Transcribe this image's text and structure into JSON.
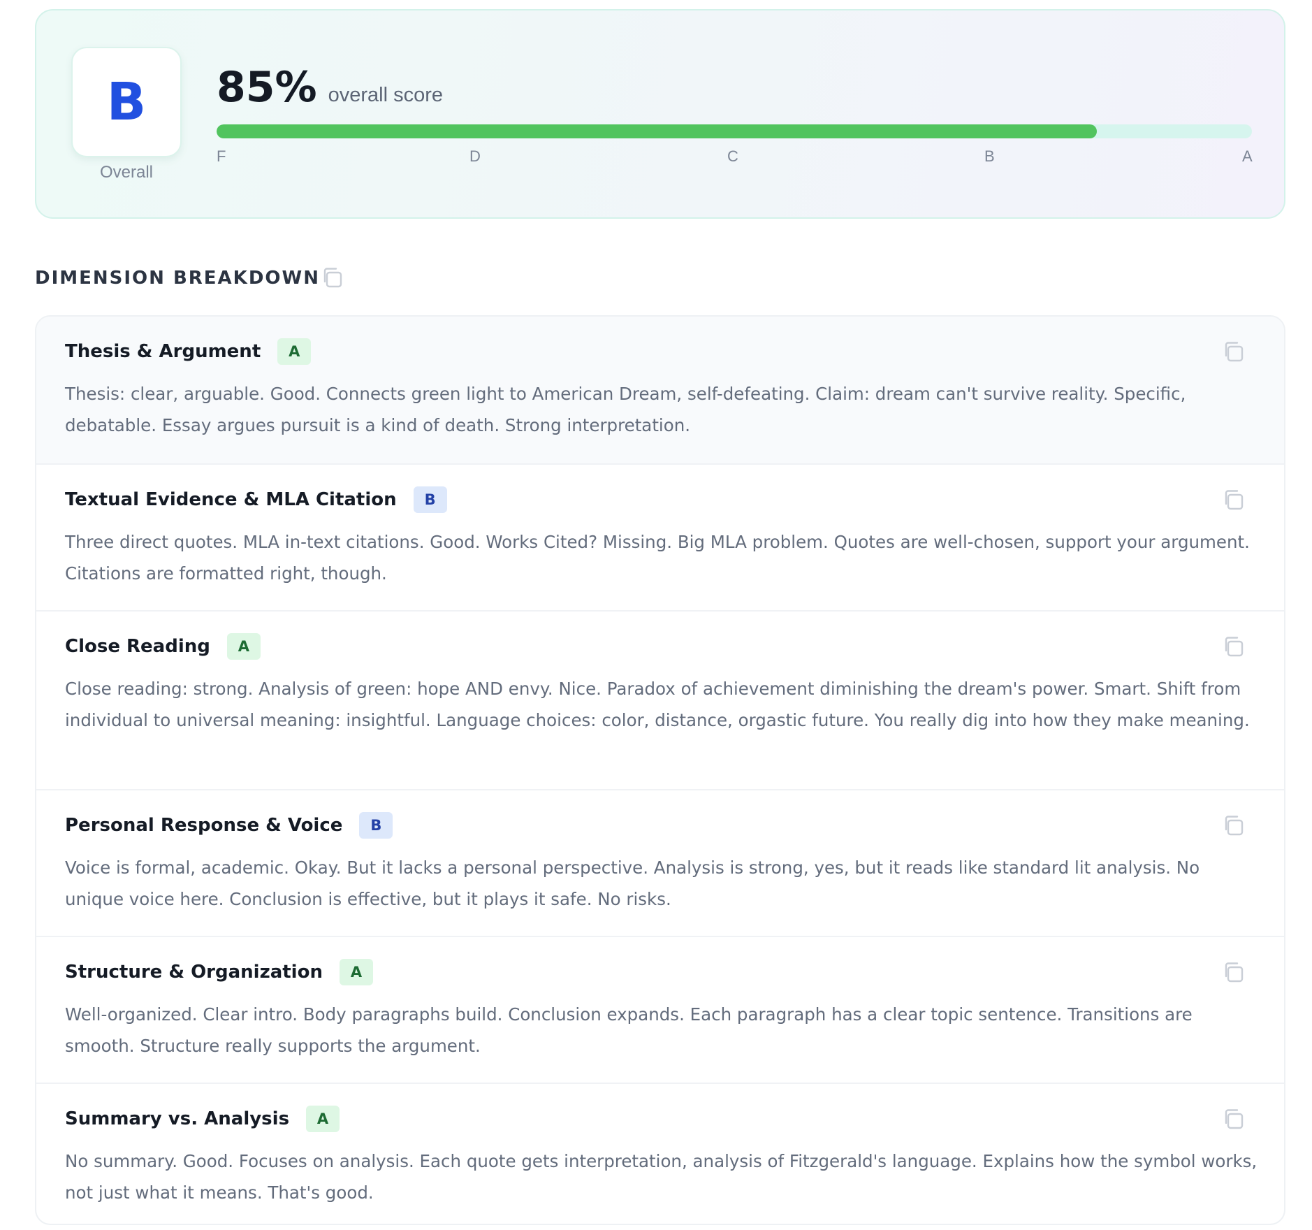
{
  "overall": {
    "grade": "B",
    "caption": "Overall",
    "score_percent": 85,
    "score_text": "85%",
    "score_label": "overall score",
    "scale": [
      "F",
      "D",
      "C",
      "B",
      "A"
    ]
  },
  "colors": {
    "grade_letter": "#2150e0",
    "progress_fill": "#51c45e",
    "progress_track": "#d6f5ee",
    "badge_a_bg": "#def7e4",
    "badge_a_text": "#1d6b33",
    "badge_b_bg": "#dde8fb",
    "badge_b_text": "#2341a6"
  },
  "section": {
    "title": "DIMENSION BREAKDOWN",
    "copy_icon": "copy-icon"
  },
  "dimensions": [
    {
      "name": "Thesis & Argument",
      "grade": "A",
      "feedback": "Thesis: clear, arguable. Good. Connects green light to American Dream, self-defeating. Claim: dream can't survive reality. Specific, debatable. Essay argues pursuit is a kind of death. Strong interpretation."
    },
    {
      "name": "Textual Evidence & MLA Citation",
      "grade": "B",
      "feedback": "Three direct quotes. MLA in-text citations. Good. Works Cited? Missing. Big MLA problem. Quotes are well-chosen, support your argument. Citations are formatted right, though."
    },
    {
      "name": "Close Reading",
      "grade": "A",
      "feedback": "Close reading: strong. Analysis of green: hope AND envy. Nice. Paradox of achievement diminishing the dream's power. Smart. Shift from individual to universal meaning: insightful. Language choices: color, distance, orgastic future. You really dig into how they make meaning."
    },
    {
      "name": "Personal Response & Voice",
      "grade": "B",
      "feedback": "Voice is formal, academic. Okay. But it lacks a personal perspective. Analysis is strong, yes, but it reads like standard lit analysis. No unique voice here. Conclusion is effective, but it plays it safe. No risks."
    },
    {
      "name": "Structure & Organization",
      "grade": "A",
      "feedback": "Well-organized. Clear intro. Body paragraphs build. Conclusion expands. Each paragraph has a clear topic sentence. Transitions are smooth. Structure really supports the argument."
    },
    {
      "name": "Summary vs. Analysis",
      "grade": "A",
      "feedback": "No summary. Good. Focuses on analysis. Each quote gets interpretation, analysis of Fitzgerald's language. Explains how the symbol works, not just what it means. That's good."
    }
  ]
}
